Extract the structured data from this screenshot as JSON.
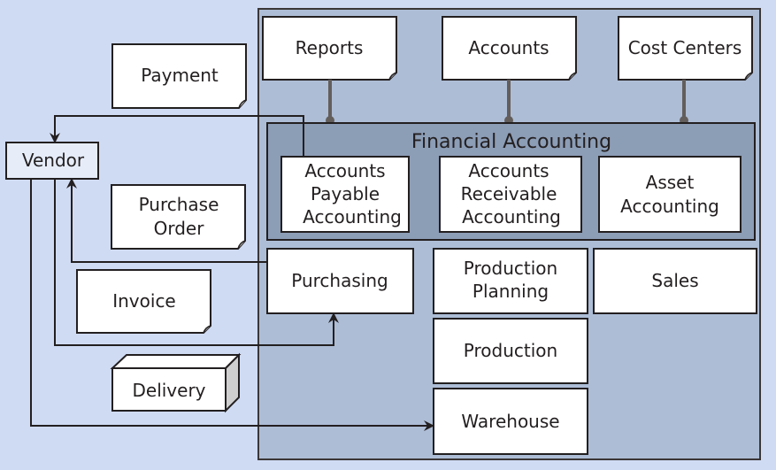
{
  "diagram": {
    "system": {
      "top_documents": [
        "Reports",
        "Accounts",
        "Cost Centers"
      ],
      "financial_accounting": {
        "title": "Financial Accounting",
        "modules": [
          [
            "Accounts",
            "Payable",
            "Accounting"
          ],
          [
            "Accounts",
            "Receivable",
            "Accounting"
          ],
          [
            "Asset",
            "Accounting"
          ]
        ]
      },
      "modules": {
        "purchasing": "Purchasing",
        "production_planning": [
          "Production",
          "Planning"
        ],
        "sales": "Sales",
        "production": "Production",
        "warehouse": "Warehouse"
      }
    },
    "vendor": "Vendor",
    "documents": {
      "payment": "Payment",
      "purchase_order": [
        "Purchase",
        "Order"
      ],
      "invoice": "Invoice",
      "delivery": "Delivery"
    },
    "colors": {
      "background": "#cfdbf3",
      "system_fill": "#adbdd6",
      "financial_fill": "#8c9db6",
      "vendor_fill": "#e6edf9",
      "stroke": "#231f20",
      "connector": "#635e5c"
    }
  }
}
